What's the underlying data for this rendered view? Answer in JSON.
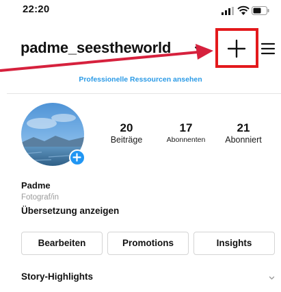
{
  "status_bar": {
    "time": "22:20",
    "icons": [
      "signal-icon",
      "wifi-icon",
      "battery-icon"
    ]
  },
  "header": {
    "username": "padme_seestheworld",
    "username_chevron_icon": "chevron-down-icon",
    "add_icon": "plus-icon",
    "menu_icon": "hamburger-menu-icon",
    "highlight_color": "#e3191c"
  },
  "banner": {
    "resources_link": "Professionelle Ressourcen ansehen",
    "link_color": "#2a9ae6"
  },
  "profile": {
    "avatar_badge_icon": "plus-icon",
    "stats": [
      {
        "value": "20",
        "label": "Beiträge"
      },
      {
        "value": "17",
        "label": "Abonnenten"
      },
      {
        "value": "21",
        "label": "Abonniert"
      }
    ],
    "name": "Padme",
    "category": "Fotograf/in",
    "translate": "Übersetzung anzeigen"
  },
  "actions": {
    "edit": "Bearbeiten",
    "promotions": "Promotions",
    "insights": "Insights"
  },
  "story_highlights": {
    "label": "Story-Highlights",
    "chevron_icon": "chevron-down-icon"
  }
}
